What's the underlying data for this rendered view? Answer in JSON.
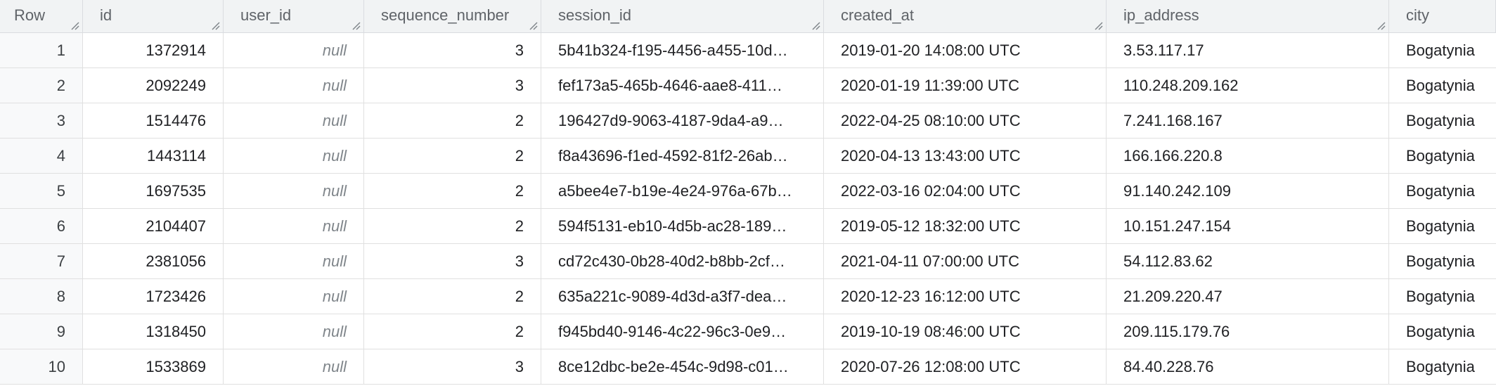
{
  "columns": {
    "row": "Row",
    "id": "id",
    "user_id": "user_id",
    "sequence_number": "sequence_number",
    "session_id": "session_id",
    "created_at": "created_at",
    "ip_address": "ip_address",
    "city": "city"
  },
  "rows": [
    {
      "row": "1",
      "id": "1372914",
      "user_id": "null",
      "sequence_number": "3",
      "session_id": "5b41b324-f195-4456-a455-10d…",
      "created_at": "2019-01-20 14:08:00 UTC",
      "ip_address": "3.53.117.17",
      "city": "Bogatynia"
    },
    {
      "row": "2",
      "id": "2092249",
      "user_id": "null",
      "sequence_number": "3",
      "session_id": "fef173a5-465b-4646-aae8-411…",
      "created_at": "2020-01-19 11:39:00 UTC",
      "ip_address": "110.248.209.162",
      "city": "Bogatynia"
    },
    {
      "row": "3",
      "id": "1514476",
      "user_id": "null",
      "sequence_number": "2",
      "session_id": "196427d9-9063-4187-9da4-a9…",
      "created_at": "2022-04-25 08:10:00 UTC",
      "ip_address": "7.241.168.167",
      "city": "Bogatynia"
    },
    {
      "row": "4",
      "id": "1443114",
      "user_id": "null",
      "sequence_number": "2",
      "session_id": "f8a43696-f1ed-4592-81f2-26ab…",
      "created_at": "2020-04-13 13:43:00 UTC",
      "ip_address": "166.166.220.8",
      "city": "Bogatynia"
    },
    {
      "row": "5",
      "id": "1697535",
      "user_id": "null",
      "sequence_number": "2",
      "session_id": "a5bee4e7-b19e-4e24-976a-67b…",
      "created_at": "2022-03-16 02:04:00 UTC",
      "ip_address": "91.140.242.109",
      "city": "Bogatynia"
    },
    {
      "row": "6",
      "id": "2104407",
      "user_id": "null",
      "sequence_number": "2",
      "session_id": "594f5131-eb10-4d5b-ac28-189…",
      "created_at": "2019-05-12 18:32:00 UTC",
      "ip_address": "10.151.247.154",
      "city": "Bogatynia"
    },
    {
      "row": "7",
      "id": "2381056",
      "user_id": "null",
      "sequence_number": "3",
      "session_id": "cd72c430-0b28-40d2-b8bb-2cf…",
      "created_at": "2021-04-11 07:00:00 UTC",
      "ip_address": "54.112.83.62",
      "city": "Bogatynia"
    },
    {
      "row": "8",
      "id": "1723426",
      "user_id": "null",
      "sequence_number": "2",
      "session_id": "635a221c-9089-4d3d-a3f7-dea…",
      "created_at": "2020-12-23 16:12:00 UTC",
      "ip_address": "21.209.220.47",
      "city": "Bogatynia"
    },
    {
      "row": "9",
      "id": "1318450",
      "user_id": "null",
      "sequence_number": "2",
      "session_id": "f945bd40-9146-4c22-96c3-0e9…",
      "created_at": "2019-10-19 08:46:00 UTC",
      "ip_address": "209.115.179.76",
      "city": "Bogatynia"
    },
    {
      "row": "10",
      "id": "1533869",
      "user_id": "null",
      "sequence_number": "3",
      "session_id": "8ce12dbc-be2e-454c-9d98-c01…",
      "created_at": "2020-07-26 12:08:00 UTC",
      "ip_address": "84.40.228.76",
      "city": "Bogatynia"
    }
  ],
  "icons": {
    "column_resize": "resize-handle-icon"
  },
  "colors": {
    "header_bg": "#f1f3f4",
    "header_text": "#5f6368",
    "null_text": "#80868b",
    "border": "#e0e0e0"
  }
}
